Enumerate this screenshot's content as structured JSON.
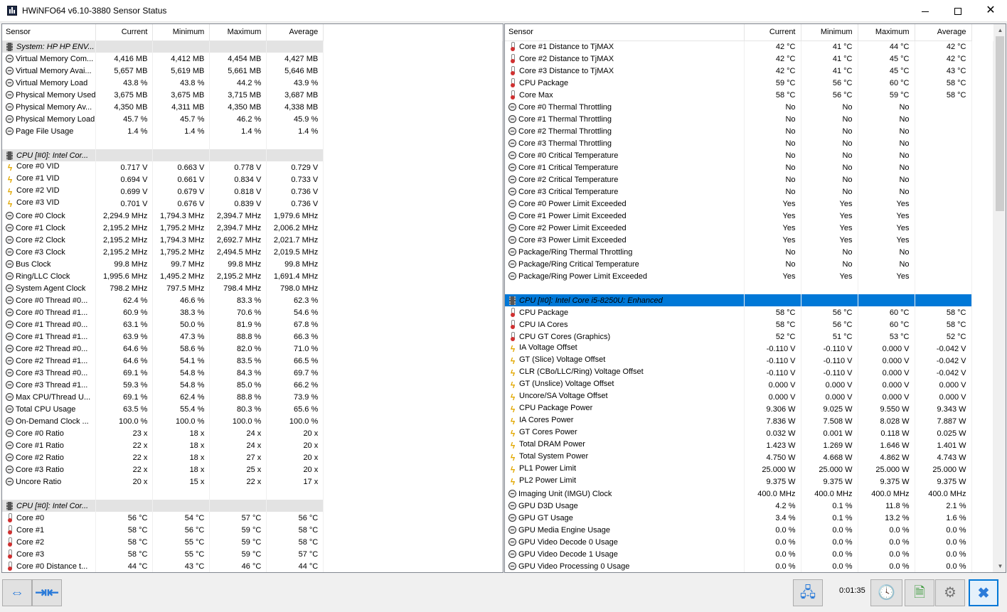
{
  "window": {
    "title": "HWiNFO64 v6.10-3880 Sensor Status"
  },
  "columns": [
    "Sensor",
    "Current",
    "Minimum",
    "Maximum",
    "Average"
  ],
  "left_rows": [
    {
      "type": "group",
      "name": "System: HP HP ENV..."
    },
    {
      "icon": "clock",
      "name": "Virtual Memory Com...",
      "cur": "4,416 MB",
      "min": "4,412 MB",
      "max": "4,454 MB",
      "avg": "4,427 MB"
    },
    {
      "icon": "clock",
      "name": "Virtual Memory Avai...",
      "cur": "5,657 MB",
      "min": "5,619 MB",
      "max": "5,661 MB",
      "avg": "5,646 MB"
    },
    {
      "icon": "clock",
      "name": "Virtual Memory Load",
      "cur": "43.8 %",
      "min": "43.8 %",
      "max": "44.2 %",
      "avg": "43.9 %"
    },
    {
      "icon": "clock",
      "name": "Physical Memory Used",
      "cur": "3,675 MB",
      "min": "3,675 MB",
      "max": "3,715 MB",
      "avg": "3,687 MB"
    },
    {
      "icon": "clock",
      "name": "Physical Memory Av...",
      "cur": "4,350 MB",
      "min": "4,311 MB",
      "max": "4,350 MB",
      "avg": "4,338 MB"
    },
    {
      "icon": "clock",
      "name": "Physical Memory Load",
      "cur": "45.7 %",
      "min": "45.7 %",
      "max": "46.2 %",
      "avg": "45.9 %"
    },
    {
      "icon": "clock",
      "name": "Page File Usage",
      "cur": "1.4 %",
      "min": "1.4 %",
      "max": "1.4 %",
      "avg": "1.4 %"
    },
    {
      "type": "spacer"
    },
    {
      "type": "group",
      "name": "CPU [#0]: Intel Cor..."
    },
    {
      "icon": "volt",
      "name": "Core #0 VID",
      "cur": "0.717 V",
      "min": "0.663 V",
      "max": "0.778 V",
      "avg": "0.729 V"
    },
    {
      "icon": "volt",
      "name": "Core #1 VID",
      "cur": "0.694 V",
      "min": "0.661 V",
      "max": "0.834 V",
      "avg": "0.733 V"
    },
    {
      "icon": "volt",
      "name": "Core #2 VID",
      "cur": "0.699 V",
      "min": "0.679 V",
      "max": "0.818 V",
      "avg": "0.736 V"
    },
    {
      "icon": "volt",
      "name": "Core #3 VID",
      "cur": "0.701 V",
      "min": "0.676 V",
      "max": "0.839 V",
      "avg": "0.736 V"
    },
    {
      "icon": "clock",
      "name": "Core #0 Clock",
      "cur": "2,294.9 MHz",
      "min": "1,794.3 MHz",
      "max": "2,394.7 MHz",
      "avg": "1,979.6 MHz"
    },
    {
      "icon": "clock",
      "name": "Core #1 Clock",
      "cur": "2,195.2 MHz",
      "min": "1,795.2 MHz",
      "max": "2,394.7 MHz",
      "avg": "2,006.2 MHz"
    },
    {
      "icon": "clock",
      "name": "Core #2 Clock",
      "cur": "2,195.2 MHz",
      "min": "1,794.3 MHz",
      "max": "2,692.7 MHz",
      "avg": "2,021.7 MHz"
    },
    {
      "icon": "clock",
      "name": "Core #3 Clock",
      "cur": "2,195.2 MHz",
      "min": "1,795.2 MHz",
      "max": "2,494.5 MHz",
      "avg": "2,019.5 MHz"
    },
    {
      "icon": "clock",
      "name": "Bus Clock",
      "cur": "99.8 MHz",
      "min": "99.7 MHz",
      "max": "99.8 MHz",
      "avg": "99.8 MHz"
    },
    {
      "icon": "clock",
      "name": "Ring/LLC Clock",
      "cur": "1,995.6 MHz",
      "min": "1,495.2 MHz",
      "max": "2,195.2 MHz",
      "avg": "1,691.4 MHz"
    },
    {
      "icon": "clock",
      "name": "System Agent Clock",
      "cur": "798.2 MHz",
      "min": "797.5 MHz",
      "max": "798.4 MHz",
      "avg": "798.0 MHz"
    },
    {
      "icon": "clock",
      "name": "Core #0 Thread #0...",
      "cur": "62.4 %",
      "min": "46.6 %",
      "max": "83.3 %",
      "avg": "62.3 %"
    },
    {
      "icon": "clock",
      "name": "Core #0 Thread #1...",
      "cur": "60.9 %",
      "min": "38.3 %",
      "max": "70.6 %",
      "avg": "54.6 %"
    },
    {
      "icon": "clock",
      "name": "Core #1 Thread #0...",
      "cur": "63.1 %",
      "min": "50.0 %",
      "max": "81.9 %",
      "avg": "67.8 %"
    },
    {
      "icon": "clock",
      "name": "Core #1 Thread #1...",
      "cur": "63.9 %",
      "min": "47.3 %",
      "max": "88.8 %",
      "avg": "66.3 %"
    },
    {
      "icon": "clock",
      "name": "Core #2 Thread #0...",
      "cur": "64.6 %",
      "min": "58.6 %",
      "max": "82.0 %",
      "avg": "71.0 %"
    },
    {
      "icon": "clock",
      "name": "Core #2 Thread #1...",
      "cur": "64.6 %",
      "min": "54.1 %",
      "max": "83.5 %",
      "avg": "66.5 %"
    },
    {
      "icon": "clock",
      "name": "Core #3 Thread #0...",
      "cur": "69.1 %",
      "min": "54.8 %",
      "max": "84.3 %",
      "avg": "69.7 %"
    },
    {
      "icon": "clock",
      "name": "Core #3 Thread #1...",
      "cur": "59.3 %",
      "min": "54.8 %",
      "max": "85.0 %",
      "avg": "66.2 %"
    },
    {
      "icon": "clock",
      "name": "Max CPU/Thread U...",
      "cur": "69.1 %",
      "min": "62.4 %",
      "max": "88.8 %",
      "avg": "73.9 %"
    },
    {
      "icon": "clock",
      "name": "Total CPU Usage",
      "cur": "63.5 %",
      "min": "55.4 %",
      "max": "80.3 %",
      "avg": "65.6 %"
    },
    {
      "icon": "clock",
      "name": "On-Demand Clock ...",
      "cur": "100.0 %",
      "min": "100.0 %",
      "max": "100.0 %",
      "avg": "100.0 %"
    },
    {
      "icon": "clock",
      "name": "Core #0 Ratio",
      "cur": "23 x",
      "min": "18 x",
      "max": "24 x",
      "avg": "20 x"
    },
    {
      "icon": "clock",
      "name": "Core #1 Ratio",
      "cur": "22 x",
      "min": "18 x",
      "max": "24 x",
      "avg": "20 x"
    },
    {
      "icon": "clock",
      "name": "Core #2 Ratio",
      "cur": "22 x",
      "min": "18 x",
      "max": "27 x",
      "avg": "20 x"
    },
    {
      "icon": "clock",
      "name": "Core #3 Ratio",
      "cur": "22 x",
      "min": "18 x",
      "max": "25 x",
      "avg": "20 x"
    },
    {
      "icon": "clock",
      "name": "Uncore Ratio",
      "cur": "20 x",
      "min": "15 x",
      "max": "22 x",
      "avg": "17 x"
    },
    {
      "type": "spacer"
    },
    {
      "type": "group",
      "name": "CPU [#0]: Intel Cor..."
    },
    {
      "icon": "therm",
      "name": "Core #0",
      "cur": "56 °C",
      "min": "54 °C",
      "max": "57 °C",
      "avg": "56 °C"
    },
    {
      "icon": "therm",
      "name": "Core #1",
      "cur": "58 °C",
      "min": "56 °C",
      "max": "59 °C",
      "avg": "58 °C"
    },
    {
      "icon": "therm",
      "name": "Core #2",
      "cur": "58 °C",
      "min": "55 °C",
      "max": "59 °C",
      "avg": "58 °C"
    },
    {
      "icon": "therm",
      "name": "Core #3",
      "cur": "58 °C",
      "min": "55 °C",
      "max": "59 °C",
      "avg": "57 °C"
    },
    {
      "icon": "therm",
      "name": "Core #0 Distance t...",
      "cur": "44 °C",
      "min": "43 °C",
      "max": "46 °C",
      "avg": "44 °C"
    }
  ],
  "right_rows": [
    {
      "icon": "therm",
      "name": "Core #1 Distance to TjMAX",
      "cur": "42 °C",
      "min": "41 °C",
      "max": "44 °C",
      "avg": "42 °C"
    },
    {
      "icon": "therm",
      "name": "Core #2 Distance to TjMAX",
      "cur": "42 °C",
      "min": "41 °C",
      "max": "45 °C",
      "avg": "42 °C"
    },
    {
      "icon": "therm",
      "name": "Core #3 Distance to TjMAX",
      "cur": "42 °C",
      "min": "41 °C",
      "max": "45 °C",
      "avg": "43 °C"
    },
    {
      "icon": "therm",
      "name": "CPU Package",
      "cur": "59 °C",
      "min": "56 °C",
      "max": "60 °C",
      "avg": "58 °C"
    },
    {
      "icon": "therm",
      "name": "Core Max",
      "cur": "58 °C",
      "min": "56 °C",
      "max": "59 °C",
      "avg": "58 °C"
    },
    {
      "icon": "clock",
      "name": "Core #0 Thermal Throttling",
      "cur": "No",
      "min": "No",
      "max": "No",
      "avg": ""
    },
    {
      "icon": "clock",
      "name": "Core #1 Thermal Throttling",
      "cur": "No",
      "min": "No",
      "max": "No",
      "avg": ""
    },
    {
      "icon": "clock",
      "name": "Core #2 Thermal Throttling",
      "cur": "No",
      "min": "No",
      "max": "No",
      "avg": ""
    },
    {
      "icon": "clock",
      "name": "Core #3 Thermal Throttling",
      "cur": "No",
      "min": "No",
      "max": "No",
      "avg": ""
    },
    {
      "icon": "clock",
      "name": "Core #0 Critical Temperature",
      "cur": "No",
      "min": "No",
      "max": "No",
      "avg": ""
    },
    {
      "icon": "clock",
      "name": "Core #1 Critical Temperature",
      "cur": "No",
      "min": "No",
      "max": "No",
      "avg": ""
    },
    {
      "icon": "clock",
      "name": "Core #2 Critical Temperature",
      "cur": "No",
      "min": "No",
      "max": "No",
      "avg": ""
    },
    {
      "icon": "clock",
      "name": "Core #3 Critical Temperature",
      "cur": "No",
      "min": "No",
      "max": "No",
      "avg": ""
    },
    {
      "icon": "clock",
      "name": "Core #0 Power Limit Exceeded",
      "cur": "Yes",
      "min": "Yes",
      "max": "Yes",
      "avg": ""
    },
    {
      "icon": "clock",
      "name": "Core #1 Power Limit Exceeded",
      "cur": "Yes",
      "min": "Yes",
      "max": "Yes",
      "avg": ""
    },
    {
      "icon": "clock",
      "name": "Core #2 Power Limit Exceeded",
      "cur": "Yes",
      "min": "Yes",
      "max": "Yes",
      "avg": ""
    },
    {
      "icon": "clock",
      "name": "Core #3 Power Limit Exceeded",
      "cur": "Yes",
      "min": "Yes",
      "max": "Yes",
      "avg": ""
    },
    {
      "icon": "clock",
      "name": "Package/Ring Thermal Throttling",
      "cur": "No",
      "min": "No",
      "max": "No",
      "avg": ""
    },
    {
      "icon": "clock",
      "name": "Package/Ring Critical Temperature",
      "cur": "No",
      "min": "No",
      "max": "No",
      "avg": ""
    },
    {
      "icon": "clock",
      "name": "Package/Ring Power Limit Exceeded",
      "cur": "Yes",
      "min": "Yes",
      "max": "Yes",
      "avg": ""
    },
    {
      "type": "spacer"
    },
    {
      "type": "group",
      "selected": true,
      "name": "CPU [#0]: Intel Core i5-8250U: Enhanced"
    },
    {
      "icon": "therm",
      "name": "CPU Package",
      "cur": "58 °C",
      "min": "56 °C",
      "max": "60 °C",
      "avg": "58 °C"
    },
    {
      "icon": "therm",
      "name": "CPU IA Cores",
      "cur": "58 °C",
      "min": "56 °C",
      "max": "60 °C",
      "avg": "58 °C"
    },
    {
      "icon": "therm",
      "name": "CPU GT Cores (Graphics)",
      "cur": "52 °C",
      "min": "51 °C",
      "max": "53 °C",
      "avg": "52 °C"
    },
    {
      "icon": "volt",
      "name": "IA Voltage Offset",
      "cur": "-0.110 V",
      "min": "-0.110 V",
      "max": "0.000 V",
      "avg": "-0.042 V"
    },
    {
      "icon": "volt",
      "name": "GT (Slice) Voltage Offset",
      "cur": "-0.110 V",
      "min": "-0.110 V",
      "max": "0.000 V",
      "avg": "-0.042 V"
    },
    {
      "icon": "volt",
      "name": "CLR (CBo/LLC/Ring) Voltage Offset",
      "cur": "-0.110 V",
      "min": "-0.110 V",
      "max": "0.000 V",
      "avg": "-0.042 V"
    },
    {
      "icon": "volt",
      "name": "GT (Unslice) Voltage Offset",
      "cur": "0.000 V",
      "min": "0.000 V",
      "max": "0.000 V",
      "avg": "0.000 V"
    },
    {
      "icon": "volt",
      "name": "Uncore/SA Voltage Offset",
      "cur": "0.000 V",
      "min": "0.000 V",
      "max": "0.000 V",
      "avg": "0.000 V"
    },
    {
      "icon": "volt",
      "name": "CPU Package Power",
      "cur": "9.306 W",
      "min": "9.025 W",
      "max": "9.550 W",
      "avg": "9.343 W"
    },
    {
      "icon": "volt",
      "name": "IA Cores Power",
      "cur": "7.836 W",
      "min": "7.508 W",
      "max": "8.028 W",
      "avg": "7.887 W"
    },
    {
      "icon": "volt",
      "name": "GT Cores Power",
      "cur": "0.032 W",
      "min": "0.001 W",
      "max": "0.118 W",
      "avg": "0.025 W"
    },
    {
      "icon": "volt",
      "name": "Total DRAM Power",
      "cur": "1.423 W",
      "min": "1.269 W",
      "max": "1.646 W",
      "avg": "1.401 W"
    },
    {
      "icon": "volt",
      "name": "Total System Power",
      "cur": "4.750 W",
      "min": "4.668 W",
      "max": "4.862 W",
      "avg": "4.743 W"
    },
    {
      "icon": "volt",
      "name": "PL1 Power Limit",
      "cur": "25.000 W",
      "min": "25.000 W",
      "max": "25.000 W",
      "avg": "25.000 W"
    },
    {
      "icon": "volt",
      "name": "PL2 Power Limit",
      "cur": "9.375 W",
      "min": "9.375 W",
      "max": "9.375 W",
      "avg": "9.375 W"
    },
    {
      "icon": "clock",
      "name": "Imaging Unit (IMGU) Clock",
      "cur": "400.0 MHz",
      "min": "400.0 MHz",
      "max": "400.0 MHz",
      "avg": "400.0 MHz"
    },
    {
      "icon": "clock",
      "name": "GPU D3D Usage",
      "cur": "4.2 %",
      "min": "0.1 %",
      "max": "11.8 %",
      "avg": "2.1 %"
    },
    {
      "icon": "clock",
      "name": "GPU GT Usage",
      "cur": "3.4 %",
      "min": "0.1 %",
      "max": "13.2 %",
      "avg": "1.6 %"
    },
    {
      "icon": "clock",
      "name": "GPU Media Engine Usage",
      "cur": "0.0 %",
      "min": "0.0 %",
      "max": "0.0 %",
      "avg": "0.0 %"
    },
    {
      "icon": "clock",
      "name": "GPU Video Decode 0 Usage",
      "cur": "0.0 %",
      "min": "0.0 %",
      "max": "0.0 %",
      "avg": "0.0 %"
    },
    {
      "icon": "clock",
      "name": "GPU Video Decode 1 Usage",
      "cur": "0.0 %",
      "min": "0.0 %",
      "max": "0.0 %",
      "avg": "0.0 %"
    },
    {
      "icon": "clock",
      "name": "GPU Video Processing 0 Usage",
      "cur": "0.0 %",
      "min": "0.0 %",
      "max": "0.0 %",
      "avg": "0.0 %"
    }
  ],
  "toolbar": {
    "timer": "0:01:35"
  },
  "colors": {
    "selection": "#0078d7",
    "group_bg": "#e3e3e3",
    "voltage_icon": "#e2a800",
    "thermometer_bulb": "#d03030"
  }
}
